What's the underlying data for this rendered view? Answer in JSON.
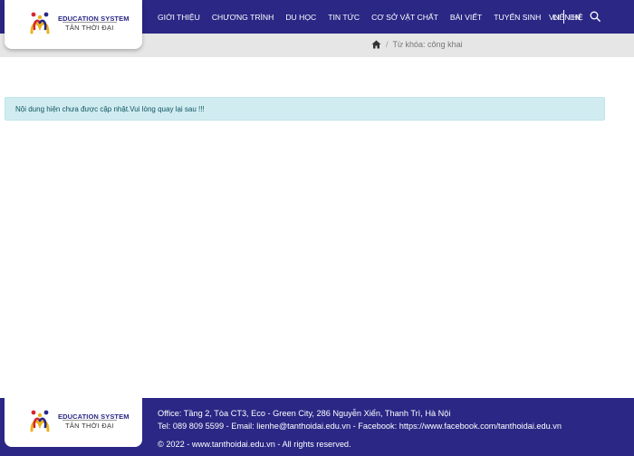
{
  "brand": {
    "title": "EDUCATION SYSTEM",
    "subtitle": "TÂN THỜI ĐẠI"
  },
  "nav": {
    "items": [
      {
        "label": "GIỚI THIỆU"
      },
      {
        "label": "CHƯƠNG TRÌNH"
      },
      {
        "label": "DU HỌC"
      },
      {
        "label": "TIN TỨC"
      },
      {
        "label": "CƠ SỞ VẬT CHẤT"
      },
      {
        "label": "BÀI VIẾT"
      },
      {
        "label": "TUYỂN SINH"
      },
      {
        "label": "LIÊN HỆ"
      }
    ],
    "lang_vn": "VN",
    "lang_en": "EN",
    "search_icon": "search-icon"
  },
  "breadcrumb": {
    "home_icon": "home-icon",
    "separator": "/",
    "current": "Từ khóa: công khai"
  },
  "alert": {
    "text": "Nội dung hiện chưa được cập nhật.Vui lòng quay lại sau !!!"
  },
  "footer": {
    "office": "Office: Tầng 2, Tòa CT3, Eco - Green City, 286 Nguyễn Xiển, Thanh Trì, Hà Nội",
    "contact": "Tel: 089 809 5599 - Email: lienhe@tanthoidai.edu.vn - Facebook: https://www.facebook.com/tanthoidai.edu.vn",
    "copyright": "© 2022 - www.tanthoidai.edu.vn - All rights reserved."
  },
  "colors": {
    "primary": "#2a2785",
    "alert_bg": "#d1ecf1",
    "alert_text": "#0c5460",
    "breadcrumb_bg": "#e6e6e6"
  }
}
